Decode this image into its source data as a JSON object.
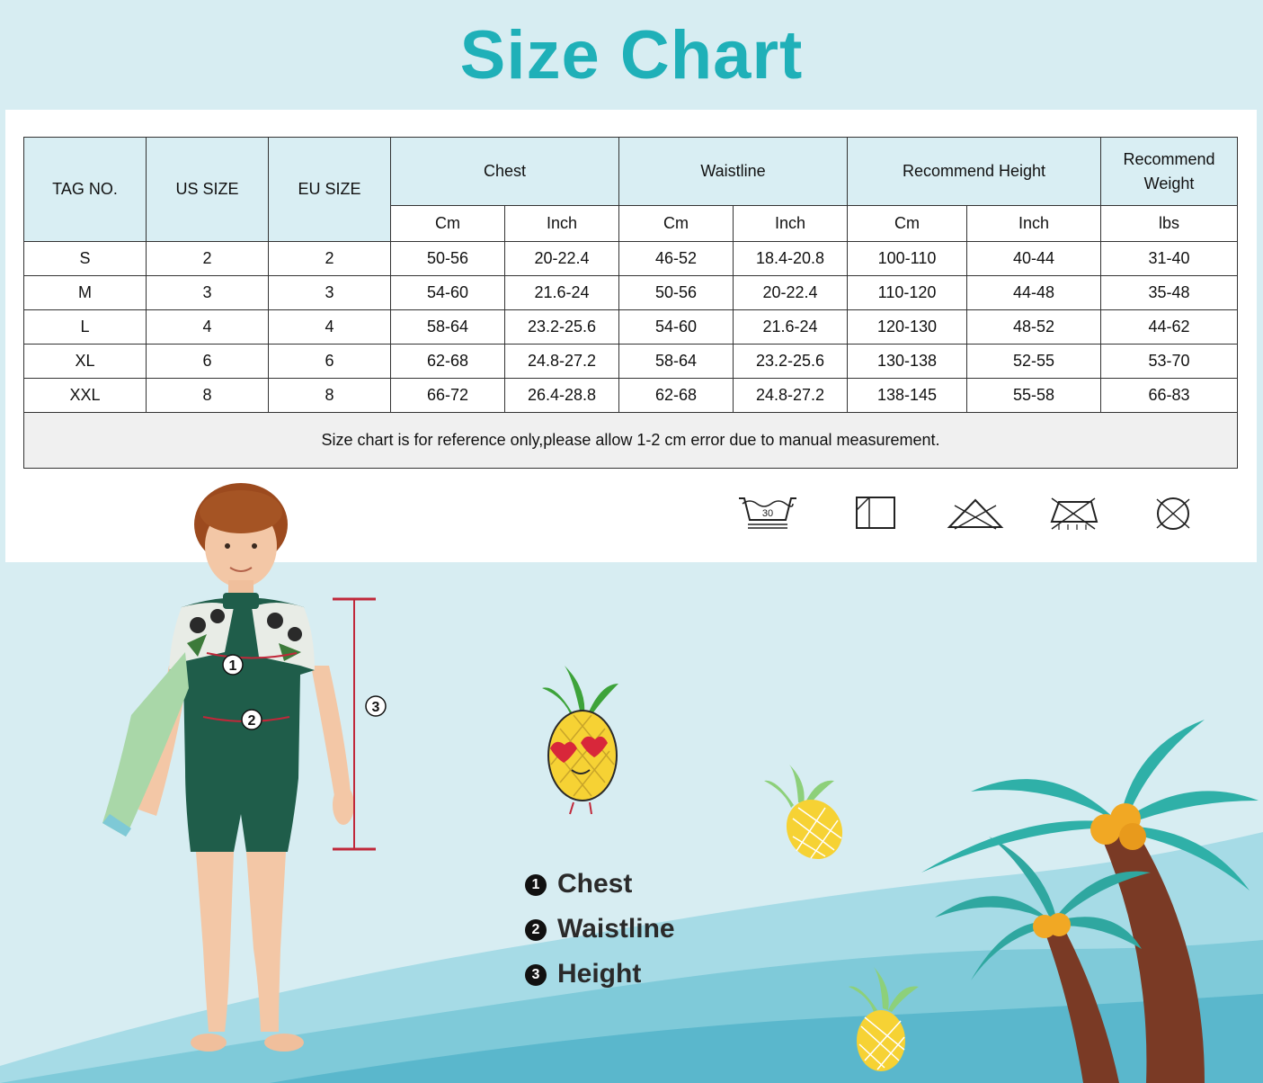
{
  "title": "Size Chart",
  "table": {
    "headers": {
      "tag_no": "TAG NO.",
      "us_size": "US SIZE",
      "eu_size": "EU SIZE",
      "chest": "Chest",
      "waistline": "Waistline",
      "recommend_height": "Recommend Height",
      "recommend_weight_line1": "Recommend",
      "recommend_weight_line2": "Weight"
    },
    "subheaders": [
      "Cm",
      "Inch",
      "Cm",
      "Inch",
      "Cm",
      "Inch",
      "lbs"
    ],
    "rows": [
      [
        "S",
        "2",
        "2",
        "50-56",
        "20-22.4",
        "46-52",
        "18.4-20.8",
        "100-110",
        "40-44",
        "31-40"
      ],
      [
        "M",
        "3",
        "3",
        "54-60",
        "21.6-24",
        "50-56",
        "20-22.4",
        "110-120",
        "44-48",
        "35-48"
      ],
      [
        "L",
        "4",
        "4",
        "58-64",
        "23.2-25.6",
        "54-60",
        "21.6-24",
        "120-130",
        "48-52",
        "44-62"
      ],
      [
        "XL",
        "6",
        "6",
        "62-68",
        "24.8-27.2",
        "58-64",
        "23.2-25.6",
        "130-138",
        "52-55",
        "53-70"
      ],
      [
        "XXL",
        "8",
        "8",
        "66-72",
        "26.4-28.8",
        "62-68",
        "24.8-27.2",
        "138-145",
        "55-58",
        "66-83"
      ]
    ],
    "note": "Size chart is for reference only,please allow 1-2 cm error due to manual measurement."
  },
  "care_icons": [
    {
      "icon": "wash-30-icon",
      "label": "30"
    },
    {
      "icon": "tumble-dry-icon"
    },
    {
      "icon": "no-bleach-icon"
    },
    {
      "icon": "no-iron-icon"
    },
    {
      "icon": "no-dry-clean-icon"
    }
  ],
  "measure_markers": {
    "chest": "1",
    "waist": "2",
    "height": "3"
  },
  "legend": [
    {
      "num": "1",
      "label": "Chest"
    },
    {
      "num": "2",
      "label": "Waistline"
    },
    {
      "num": "3",
      "label": "Height"
    }
  ],
  "colors": {
    "title": "#1fb0b8",
    "background": "#d7edf2",
    "header_fill": "#d9eef3",
    "wetsuit": "#1f5d4a",
    "measure_line": "#c0283a"
  }
}
